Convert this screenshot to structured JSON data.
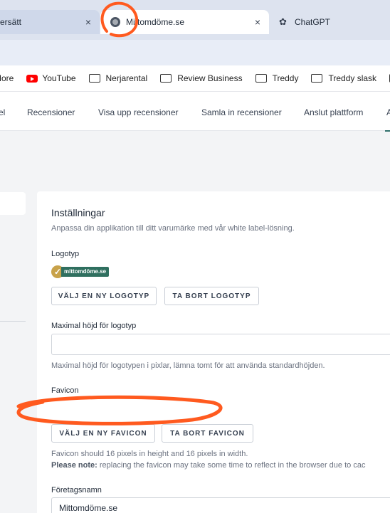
{
  "browser": {
    "tabs": [
      {
        "label": "ersätt"
      },
      {
        "label": "Mittomdöme.se"
      },
      {
        "label": "ChatGPT"
      }
    ],
    "close_glyph": "×"
  },
  "bookmarks": {
    "items": [
      {
        "label": "More",
        "icon": ""
      },
      {
        "label": "YouTube",
        "icon": "youtube-icon"
      },
      {
        "label": "Nerjarental",
        "icon": "folder-icon"
      },
      {
        "label": "Review Business",
        "icon": "folder-icon"
      },
      {
        "label": "Treddy",
        "icon": "folder-icon"
      },
      {
        "label": "Treddy slask",
        "icon": "folder-icon"
      }
    ]
  },
  "sitenav": {
    "items": [
      {
        "label": "el"
      },
      {
        "label": "Recensioner"
      },
      {
        "label": "Visa upp recensioner"
      },
      {
        "label": "Samla in recensioner"
      },
      {
        "label": "Anslut plattform"
      },
      {
        "label": "A"
      }
    ]
  },
  "settings": {
    "title": "Inställningar",
    "subtitle": "Anpassa din applikation till ditt varumärke med vår white label-lösning.",
    "logo_label": "Logotyp",
    "logo_text": "mittomdöme.se",
    "choose_logo_button": "VÄLJ EN NY LOGOTYP",
    "remove_logo_button": "TA BORT LOGOTYP",
    "max_height_label": "Maximal höjd för logotyp",
    "max_height_value": "",
    "max_height_help": "Maximal höjd för logotypen i pixlar, lämna tomt för att använda standardhöjden.",
    "favicon_label": "Favicon",
    "choose_favicon_button": "VÄLJ EN NY FAVICON",
    "remove_favicon_button": "TA BORT FAVICON",
    "favicon_help": "Favicon should 16 pixels in height and 16 pixels in width.",
    "favicon_note_bold": "Please note:",
    "favicon_note": " replacing the favicon may take some time to reflect in the browser due to cac",
    "company_label": "Företagsnamn",
    "company_value": "Mittomdöme.se"
  },
  "colors": {
    "annotation": "#ff5a1f",
    "accent": "#2f6f6b"
  }
}
